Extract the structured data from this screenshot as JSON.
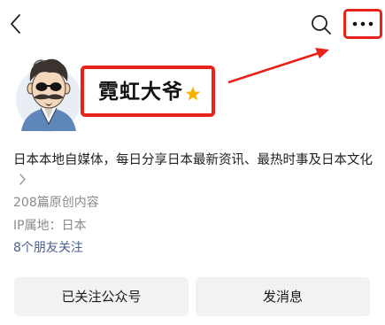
{
  "nav": {
    "back_icon": "chevron-left-icon",
    "search_icon": "search-icon",
    "more_icon": "more-dots-icon"
  },
  "profile": {
    "name": "霓虹大爷",
    "badge_icon": "star-icon",
    "bio": "日本本地自媒体，每日分享日本最新资讯、最热时事及日本文化",
    "article_count": "208篇原创内容",
    "ip_location": "IP属地：日本",
    "friends_following": "8个朋友关注"
  },
  "actions": {
    "followed_label": "已关注公众号",
    "message_label": "发消息"
  },
  "colors": {
    "highlight": "#e8221b",
    "star": "#f5b300",
    "link": "#4a5f8f",
    "button_bg": "#f2f2f2",
    "secondary_text": "#8a8a8a"
  }
}
